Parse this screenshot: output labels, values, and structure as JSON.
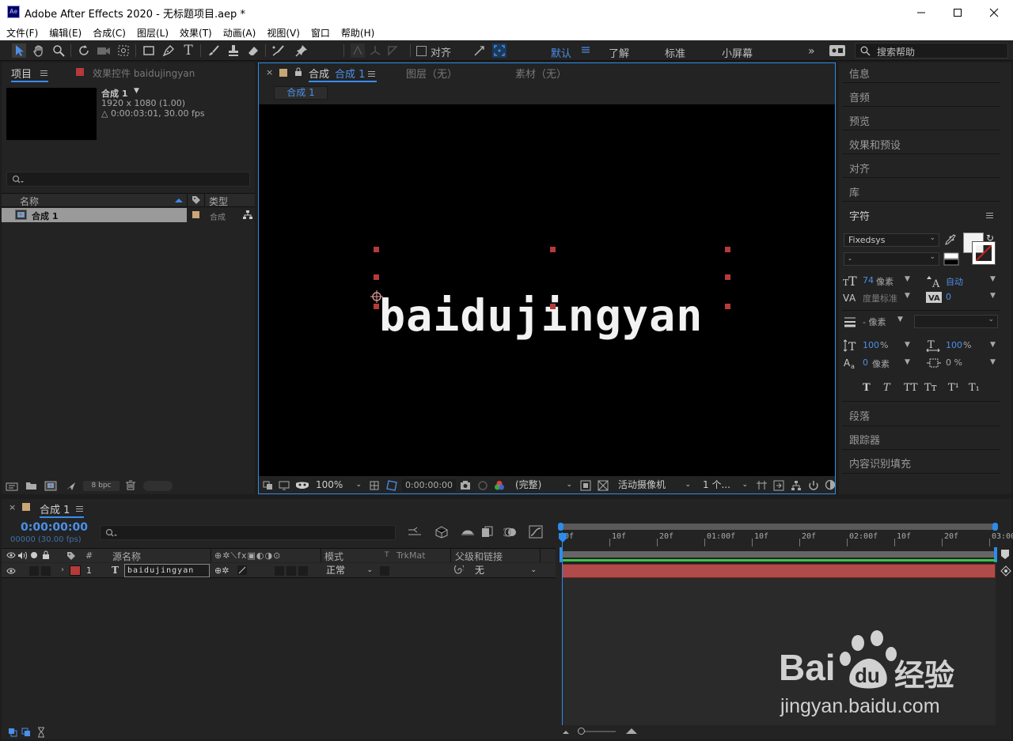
{
  "window": {
    "logo": "Ae",
    "title": "Adobe After Effects 2020 - 无标题项目.aep *"
  },
  "menu": [
    "文件(F)",
    "编辑(E)",
    "合成(C)",
    "图层(L)",
    "效果(T)",
    "动画(A)",
    "视图(V)",
    "窗口",
    "帮助(H)"
  ],
  "toolbar": {
    "snap_label": "对齐",
    "workspaces": [
      "默认",
      "了解",
      "标准",
      "小屏幕"
    ],
    "active_workspace": "默认",
    "search_placeholder": "搜索帮助"
  },
  "project": {
    "tab_label": "项目",
    "effects_tab": "效果控件 baidujingyan",
    "comp_name": "合成 1",
    "comp_resolution": "1920 x 1080 (1.00)",
    "comp_duration": "△ 0:00:03:01, 30.00 fps",
    "col_name": "名称",
    "col_type": "类型",
    "items": [
      {
        "name": "合成 1",
        "type": "合成"
      }
    ],
    "bpc": "8 bpc"
  },
  "viewer": {
    "tab_prefix": "合成",
    "comp_tab": "合成 1",
    "layer_tab": "图层（无）",
    "footage_tab": "素材（无）",
    "breadcrumb": "合成 1",
    "canvas_text": "baidujingyan",
    "zoom": "100%",
    "timecode": "0:00:00:00",
    "resolution": "(完整)",
    "camera": "活动摄像机",
    "views": "1 个..."
  },
  "right_panels": {
    "top": [
      "信息",
      "音频",
      "预览",
      "效果和预设",
      "对齐",
      "库"
    ],
    "character_title": "字符",
    "font": "Fixedsys",
    "font_style": "-",
    "size": "74",
    "size_unit": "像素",
    "leading": "自动",
    "kerning": "度量标准",
    "tracking": "0",
    "stroke": "- 像素",
    "vscale": "100",
    "hscale": "100",
    "pct": "%",
    "baseline": "0",
    "baseline_unit": "像素",
    "tsume": "0 %",
    "styles": [
      "T",
      "T",
      "TT",
      "Tт",
      "T¹",
      "T₁"
    ],
    "bottom": [
      "段落",
      "跟踪器",
      "内容识别填充"
    ]
  },
  "timeline": {
    "tab": "合成 1",
    "timecode": "0:00:00:00",
    "fps": "00000 (30.00 fps)",
    "columns": {
      "num": "#",
      "source": "源名称",
      "mode": "模式",
      "t": "T",
      "trkmat": "TrkMat",
      "parent": "父级和链接"
    },
    "ruler": [
      "0f",
      "10f",
      "20f",
      "01:00f",
      "10f",
      "20f",
      "02:00f",
      "10f",
      "20f",
      "03:00"
    ],
    "layers": [
      {
        "num": "1",
        "type": "T",
        "name": "baidujingyan",
        "mode": "正常",
        "parent": "无",
        "color": "#b53a3a"
      }
    ]
  },
  "watermark": {
    "brand": "Bai",
    "brand2": "du",
    "text": "经验",
    "url": "jingyan.baidu.com"
  },
  "colors": {
    "accent": "#2d8ceb",
    "label_red": "#b53a3a",
    "label_tan": "#c9a676"
  }
}
